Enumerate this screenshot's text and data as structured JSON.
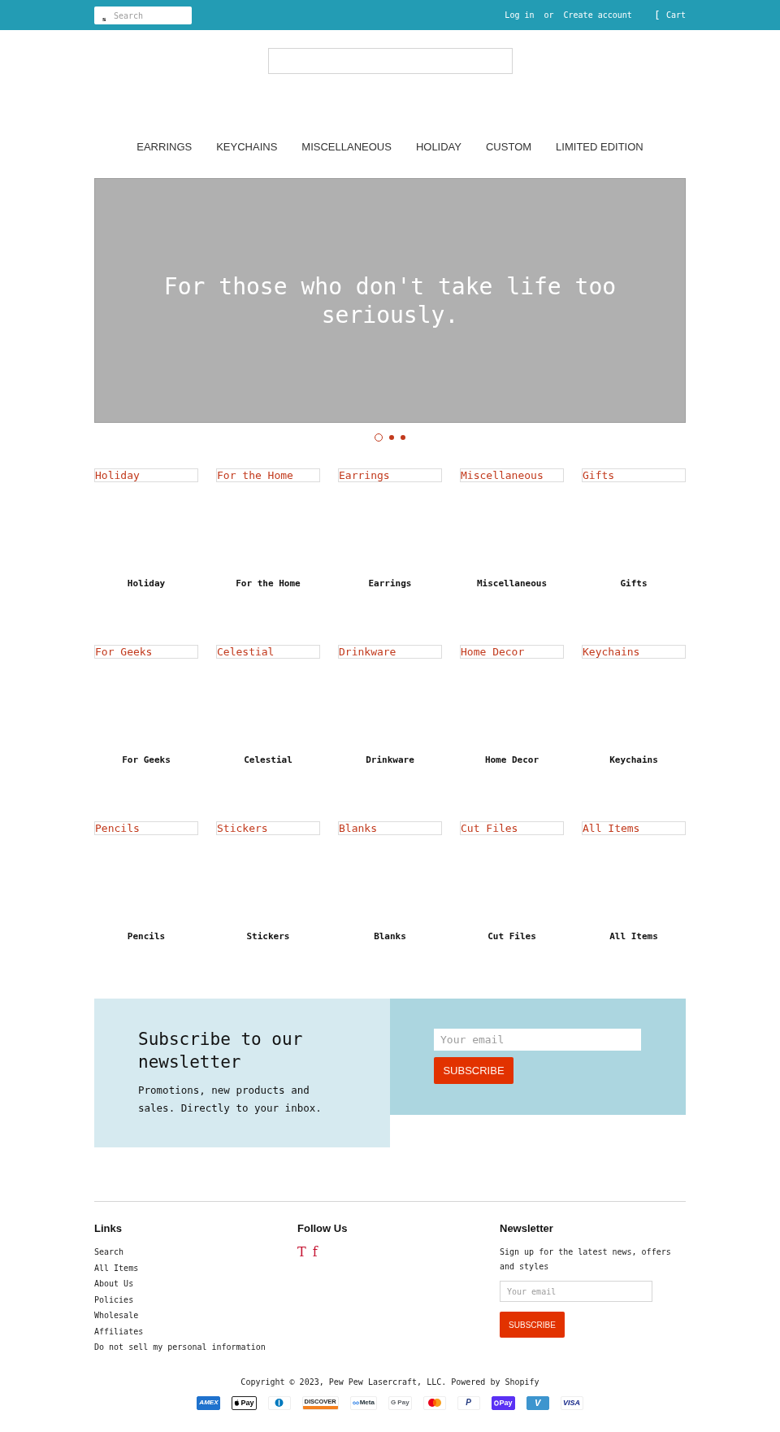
{
  "top_bar": {
    "search": {
      "icon": "s",
      "placeholder": "Search"
    },
    "login": "Log in",
    "separator": "or",
    "register": "Create account",
    "cart": {
      "icon": "[",
      "label": "Cart"
    }
  },
  "nav": [
    "EARRINGS",
    "KEYCHAINS",
    "MISCELLANEOUS",
    "HOLIDAY",
    "CUSTOM",
    "LIMITED EDITION"
  ],
  "hero": {
    "heading": "For those who don't take life too seriously."
  },
  "slides": [
    {
      "selected": true
    },
    {
      "selected": false
    },
    {
      "selected": false
    }
  ],
  "collections": [
    {
      "image_alt": "Holiday",
      "name": "Holiday"
    },
    {
      "image_alt": "For the Home",
      "name": "For the Home"
    },
    {
      "image_alt": "Earrings",
      "name": "Earrings"
    },
    {
      "image_alt": "Miscellaneous",
      "name": "Miscellaneous"
    },
    {
      "image_alt": "Gifts",
      "name": "Gifts"
    },
    {
      "image_alt": "For Geeks",
      "name": "For Geeks"
    },
    {
      "image_alt": "Celestial",
      "name": "Celestial"
    },
    {
      "image_alt": "Drinkware",
      "name": "Drinkware"
    },
    {
      "image_alt": "Home Decor",
      "name": "Home Decor"
    },
    {
      "image_alt": "Keychains",
      "name": "Keychains"
    },
    {
      "image_alt": "Pencils",
      "name": "Pencils"
    },
    {
      "image_alt": "Stickers",
      "name": "Stickers"
    },
    {
      "image_alt": "Blanks",
      "name": "Blanks"
    },
    {
      "image_alt": "Cut Files",
      "name": "Cut Files"
    },
    {
      "image_alt": "All Items",
      "name": "All Items"
    }
  ],
  "newsletter": {
    "heading": "Subscribe to our newsletter",
    "text": "Promotions, new products and sales. Directly to your inbox.",
    "email": {
      "placeholder": "Your email"
    },
    "button": "SUBSCRIBE"
  },
  "footer": {
    "links": {
      "heading": "Links",
      "items": [
        "Search",
        "All Items",
        "About Us",
        "Policies",
        "Wholesale",
        "Affiliates",
        "Do not sell my personal information"
      ]
    },
    "follow": {
      "heading": "Follow Us",
      "icons": [
        "T",
        "f"
      ]
    },
    "newsletter": {
      "heading": "Newsletter",
      "text": "Sign up for the latest news, offers and styles",
      "email": {
        "placeholder": "Your email"
      },
      "button": "SUBSCRIBE"
    }
  },
  "copyright": "Copyright © 2023, Pew Pew Lasercraft, LLC. Powered by Shopify",
  "payment_icons": [
    {
      "kind": "amex",
      "text": "AMEX"
    },
    {
      "kind": "apple",
      "text": "Pay"
    },
    {
      "kind": "diners"
    },
    {
      "kind": "discover",
      "text": "DISCOVER"
    },
    {
      "kind": "meta",
      "text": "Meta"
    },
    {
      "kind": "gpay",
      "text": "G Pay"
    },
    {
      "kind": "mastercard"
    },
    {
      "kind": "paypal",
      "text": "P"
    },
    {
      "kind": "shop",
      "text": "Pay"
    },
    {
      "kind": "venmo",
      "text": "V"
    },
    {
      "kind": "visa",
      "text": "VISA"
    }
  ]
}
